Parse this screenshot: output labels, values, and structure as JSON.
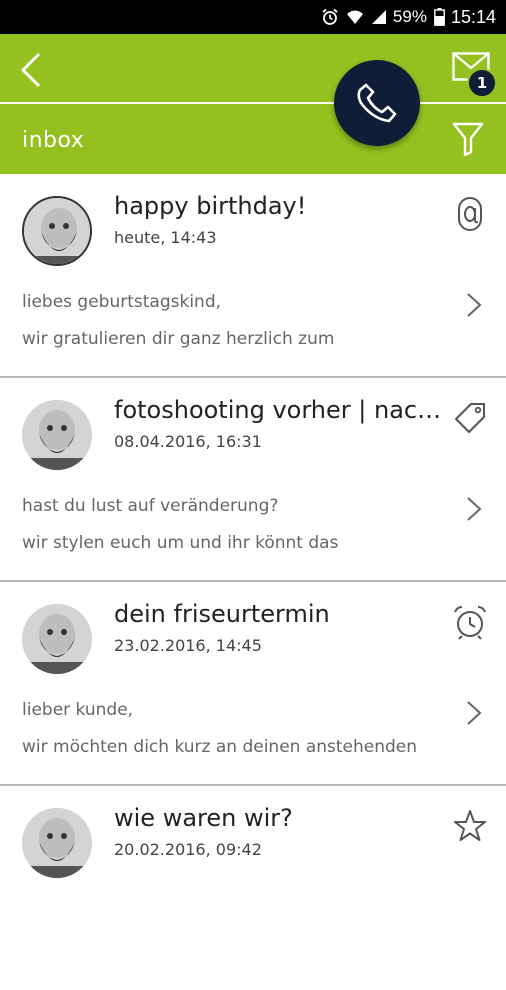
{
  "status_bar": {
    "battery_percent": "59%",
    "time": "15:14",
    "icons": [
      "alarm-icon",
      "wifi-icon",
      "signal-icon",
      "battery-icon"
    ]
  },
  "header": {
    "title": "inbox",
    "unread_badge": "1",
    "colors": {
      "accent": "#94c11f",
      "dark": "#0f1e36"
    },
    "icons": [
      "back-arrow-icon",
      "mail-icon",
      "phone-icon",
      "filter-icon"
    ]
  },
  "messages": [
    {
      "subject": "happy birthday!",
      "date": "heute, 14:43",
      "preview_line1": "liebes geburtstagskind,",
      "preview_line2": "wir gratulieren dir ganz herzlich zum",
      "icon": "at-icon"
    },
    {
      "subject": "fotoshooting vorher | nachher",
      "date": "08.04.2016, 16:31",
      "preview_line1": "hast du lust auf veränderung?",
      "preview_line2": "wir stylen euch um und ihr könnt das",
      "icon": "tag-icon"
    },
    {
      "subject": "dein friseurtermin",
      "date": "23.02.2016, 14:45",
      "preview_line1": "lieber kunde,",
      "preview_line2": "wir möchten dich kurz an deinen anstehenden",
      "icon": "alarm-clock-icon"
    },
    {
      "subject": "wie waren wir?",
      "date": "20.02.2016, 09:42",
      "preview_line1": "",
      "preview_line2": "",
      "icon": "star-icon"
    }
  ]
}
